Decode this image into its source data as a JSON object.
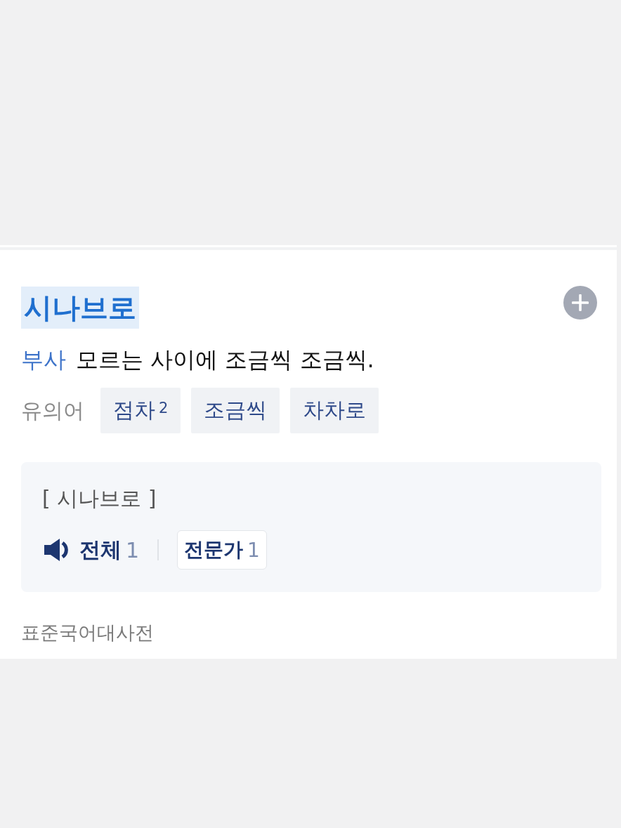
{
  "entry": {
    "headword": "시나브로",
    "highlighted": true
  },
  "definition": {
    "part_of_speech": "부사",
    "text": "모르는 사이에 조금씩 조금씩."
  },
  "synonyms": {
    "label": "유의어",
    "items": [
      {
        "word": "점차$^{2}$"
      },
      {
        "word": "조금씩"
      },
      {
        "word": "차차로"
      }
    ]
  },
  "pronunciation": {
    "text": "[ 시나브로 ]",
    "options": [
      {
        "kind": "audio",
        "label": "전체",
        "count": "1"
      },
      {
        "kind": "chip",
        "label": "전문가",
        "count": "1"
      }
    ]
  },
  "source": "표준국어대사전"
}
